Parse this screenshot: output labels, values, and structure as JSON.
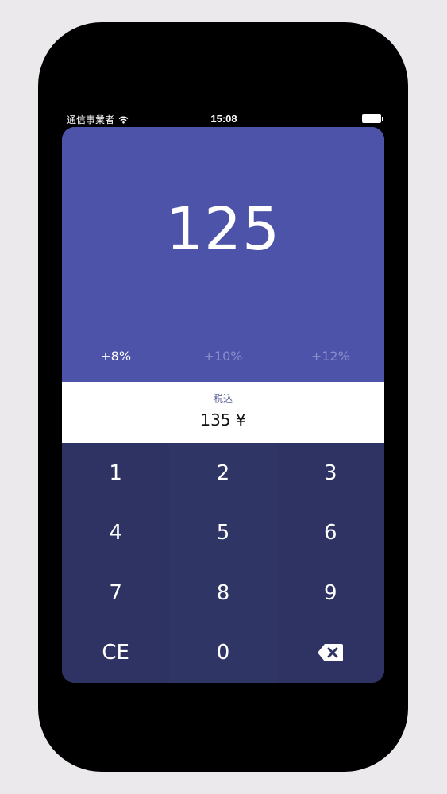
{
  "status_bar": {
    "carrier": "通信事業者",
    "time": "15:08",
    "wifi_icon": "wifi-icon",
    "battery_icon": "battery-icon"
  },
  "display": {
    "amount": "125"
  },
  "tax_rates": [
    {
      "label": "+8%",
      "selected": true
    },
    {
      "label": "+10%",
      "selected": false
    },
    {
      "label": "+12%",
      "selected": false
    }
  ],
  "result": {
    "label": "税込",
    "value": "135 ¥"
  },
  "keypad": {
    "keys": [
      "1",
      "2",
      "3",
      "4",
      "5",
      "6",
      "7",
      "8",
      "9",
      "CE",
      "0"
    ],
    "backspace_icon": "backspace-icon"
  },
  "colors": {
    "primary": "#4d53a8",
    "keypad": "#2e3363",
    "inactive_rate": "#8a8fcc"
  }
}
